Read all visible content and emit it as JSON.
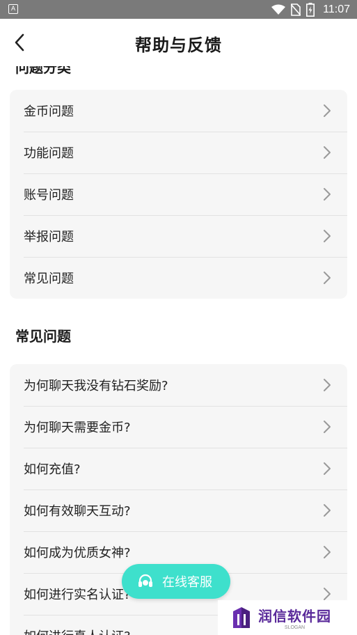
{
  "status_bar": {
    "time": "11:07",
    "icons": [
      "app-notification-icon",
      "wifi-icon",
      "no-sim-icon",
      "battery-charging-icon"
    ]
  },
  "header": {
    "title": "帮助与反馈",
    "back_icon": "back-arrow-icon"
  },
  "categories": {
    "items": [
      {
        "label": "金币问题"
      },
      {
        "label": "功能问题"
      },
      {
        "label": "账号问题"
      },
      {
        "label": "举报问题"
      },
      {
        "label": "常见问题"
      }
    ]
  },
  "faq": {
    "heading": "常见问题",
    "items": [
      {
        "label": "为何聊天我没有钻石奖励?"
      },
      {
        "label": "为何聊天需要金币?"
      },
      {
        "label": "如何充值?"
      },
      {
        "label": "如何有效聊天互动?"
      },
      {
        "label": "如何成为优质女神?"
      },
      {
        "label": "如何进行实名认证?"
      },
      {
        "label": "如何进行真人认证?"
      }
    ]
  },
  "fab": {
    "label": "在线客服",
    "icon": "headset-icon"
  },
  "watermark": {
    "name": "润信软件园",
    "slogan": "SLOGAN"
  },
  "colors": {
    "accent": "#3ee0cc",
    "status_bar": "#7a7a7a",
    "card_bg": "#f6f6f6",
    "watermark": "#5a2a9a"
  }
}
